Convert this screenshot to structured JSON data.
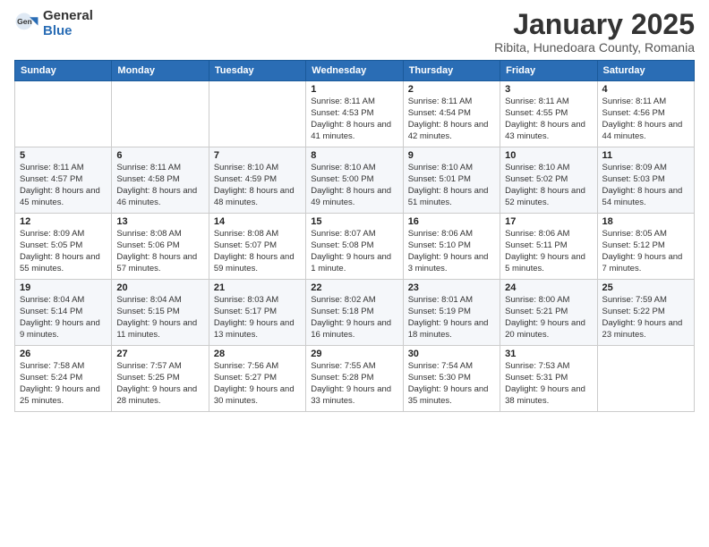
{
  "logo": {
    "general": "General",
    "blue": "Blue"
  },
  "header": {
    "month": "January 2025",
    "location": "Ribita, Hunedoara County, Romania"
  },
  "weekdays": [
    "Sunday",
    "Monday",
    "Tuesday",
    "Wednesday",
    "Thursday",
    "Friday",
    "Saturday"
  ],
  "weeks": [
    [
      {
        "day": "",
        "sunrise": "",
        "sunset": "",
        "daylight": ""
      },
      {
        "day": "",
        "sunrise": "",
        "sunset": "",
        "daylight": ""
      },
      {
        "day": "",
        "sunrise": "",
        "sunset": "",
        "daylight": ""
      },
      {
        "day": "1",
        "sunrise": "Sunrise: 8:11 AM",
        "sunset": "Sunset: 4:53 PM",
        "daylight": "Daylight: 8 hours and 41 minutes."
      },
      {
        "day": "2",
        "sunrise": "Sunrise: 8:11 AM",
        "sunset": "Sunset: 4:54 PM",
        "daylight": "Daylight: 8 hours and 42 minutes."
      },
      {
        "day": "3",
        "sunrise": "Sunrise: 8:11 AM",
        "sunset": "Sunset: 4:55 PM",
        "daylight": "Daylight: 8 hours and 43 minutes."
      },
      {
        "day": "4",
        "sunrise": "Sunrise: 8:11 AM",
        "sunset": "Sunset: 4:56 PM",
        "daylight": "Daylight: 8 hours and 44 minutes."
      }
    ],
    [
      {
        "day": "5",
        "sunrise": "Sunrise: 8:11 AM",
        "sunset": "Sunset: 4:57 PM",
        "daylight": "Daylight: 8 hours and 45 minutes."
      },
      {
        "day": "6",
        "sunrise": "Sunrise: 8:11 AM",
        "sunset": "Sunset: 4:58 PM",
        "daylight": "Daylight: 8 hours and 46 minutes."
      },
      {
        "day": "7",
        "sunrise": "Sunrise: 8:10 AM",
        "sunset": "Sunset: 4:59 PM",
        "daylight": "Daylight: 8 hours and 48 minutes."
      },
      {
        "day": "8",
        "sunrise": "Sunrise: 8:10 AM",
        "sunset": "Sunset: 5:00 PM",
        "daylight": "Daylight: 8 hours and 49 minutes."
      },
      {
        "day": "9",
        "sunrise": "Sunrise: 8:10 AM",
        "sunset": "Sunset: 5:01 PM",
        "daylight": "Daylight: 8 hours and 51 minutes."
      },
      {
        "day": "10",
        "sunrise": "Sunrise: 8:10 AM",
        "sunset": "Sunset: 5:02 PM",
        "daylight": "Daylight: 8 hours and 52 minutes."
      },
      {
        "day": "11",
        "sunrise": "Sunrise: 8:09 AM",
        "sunset": "Sunset: 5:03 PM",
        "daylight": "Daylight: 8 hours and 54 minutes."
      }
    ],
    [
      {
        "day": "12",
        "sunrise": "Sunrise: 8:09 AM",
        "sunset": "Sunset: 5:05 PM",
        "daylight": "Daylight: 8 hours and 55 minutes."
      },
      {
        "day": "13",
        "sunrise": "Sunrise: 8:08 AM",
        "sunset": "Sunset: 5:06 PM",
        "daylight": "Daylight: 8 hours and 57 minutes."
      },
      {
        "day": "14",
        "sunrise": "Sunrise: 8:08 AM",
        "sunset": "Sunset: 5:07 PM",
        "daylight": "Daylight: 8 hours and 59 minutes."
      },
      {
        "day": "15",
        "sunrise": "Sunrise: 8:07 AM",
        "sunset": "Sunset: 5:08 PM",
        "daylight": "Daylight: 9 hours and 1 minute."
      },
      {
        "day": "16",
        "sunrise": "Sunrise: 8:06 AM",
        "sunset": "Sunset: 5:10 PM",
        "daylight": "Daylight: 9 hours and 3 minutes."
      },
      {
        "day": "17",
        "sunrise": "Sunrise: 8:06 AM",
        "sunset": "Sunset: 5:11 PM",
        "daylight": "Daylight: 9 hours and 5 minutes."
      },
      {
        "day": "18",
        "sunrise": "Sunrise: 8:05 AM",
        "sunset": "Sunset: 5:12 PM",
        "daylight": "Daylight: 9 hours and 7 minutes."
      }
    ],
    [
      {
        "day": "19",
        "sunrise": "Sunrise: 8:04 AM",
        "sunset": "Sunset: 5:14 PM",
        "daylight": "Daylight: 9 hours and 9 minutes."
      },
      {
        "day": "20",
        "sunrise": "Sunrise: 8:04 AM",
        "sunset": "Sunset: 5:15 PM",
        "daylight": "Daylight: 9 hours and 11 minutes."
      },
      {
        "day": "21",
        "sunrise": "Sunrise: 8:03 AM",
        "sunset": "Sunset: 5:17 PM",
        "daylight": "Daylight: 9 hours and 13 minutes."
      },
      {
        "day": "22",
        "sunrise": "Sunrise: 8:02 AM",
        "sunset": "Sunset: 5:18 PM",
        "daylight": "Daylight: 9 hours and 16 minutes."
      },
      {
        "day": "23",
        "sunrise": "Sunrise: 8:01 AM",
        "sunset": "Sunset: 5:19 PM",
        "daylight": "Daylight: 9 hours and 18 minutes."
      },
      {
        "day": "24",
        "sunrise": "Sunrise: 8:00 AM",
        "sunset": "Sunset: 5:21 PM",
        "daylight": "Daylight: 9 hours and 20 minutes."
      },
      {
        "day": "25",
        "sunrise": "Sunrise: 7:59 AM",
        "sunset": "Sunset: 5:22 PM",
        "daylight": "Daylight: 9 hours and 23 minutes."
      }
    ],
    [
      {
        "day": "26",
        "sunrise": "Sunrise: 7:58 AM",
        "sunset": "Sunset: 5:24 PM",
        "daylight": "Daylight: 9 hours and 25 minutes."
      },
      {
        "day": "27",
        "sunrise": "Sunrise: 7:57 AM",
        "sunset": "Sunset: 5:25 PM",
        "daylight": "Daylight: 9 hours and 28 minutes."
      },
      {
        "day": "28",
        "sunrise": "Sunrise: 7:56 AM",
        "sunset": "Sunset: 5:27 PM",
        "daylight": "Daylight: 9 hours and 30 minutes."
      },
      {
        "day": "29",
        "sunrise": "Sunrise: 7:55 AM",
        "sunset": "Sunset: 5:28 PM",
        "daylight": "Daylight: 9 hours and 33 minutes."
      },
      {
        "day": "30",
        "sunrise": "Sunrise: 7:54 AM",
        "sunset": "Sunset: 5:30 PM",
        "daylight": "Daylight: 9 hours and 35 minutes."
      },
      {
        "day": "31",
        "sunrise": "Sunrise: 7:53 AM",
        "sunset": "Sunset: 5:31 PM",
        "daylight": "Daylight: 9 hours and 38 minutes."
      },
      {
        "day": "",
        "sunrise": "",
        "sunset": "",
        "daylight": ""
      }
    ]
  ]
}
